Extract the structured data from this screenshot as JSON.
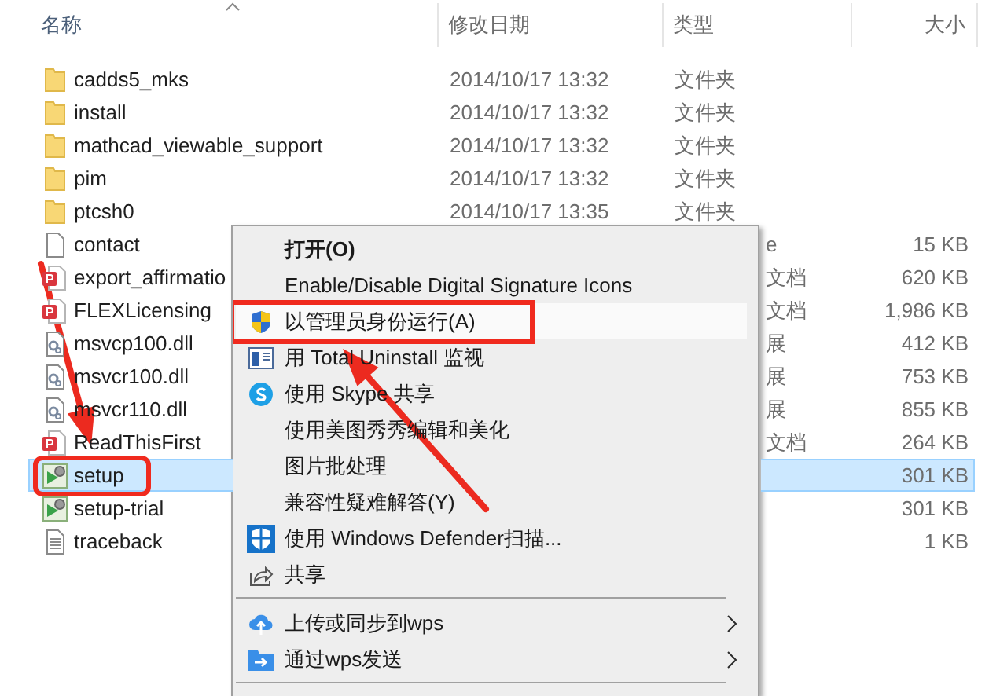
{
  "columns": [
    {
      "label": "名称",
      "sorted": true
    },
    {
      "label": "修改日期",
      "sorted": false
    },
    {
      "label": "类型",
      "sorted": false
    },
    {
      "label": "大小",
      "sorted": false
    }
  ],
  "rows": [
    {
      "kind": "folder",
      "name": "cadds5_mks",
      "date": "2014/10/17 13:32",
      "type": "文件夹",
      "selected": false
    },
    {
      "kind": "folder",
      "name": "install",
      "date": "2014/10/17 13:32",
      "type": "文件夹",
      "selected": false
    },
    {
      "kind": "folder",
      "name": "mathcad_viewable_support",
      "date": "2014/10/17 13:32",
      "type": "文件夹",
      "selected": false
    },
    {
      "kind": "folder",
      "name": "pim",
      "date": "2014/10/17 13:32",
      "type": "文件夹",
      "selected": false
    },
    {
      "kind": "folder",
      "name": "ptcsh0",
      "date": "2014/10/17 13:35",
      "type": "文件夹",
      "selected": false
    },
    {
      "kind": "file",
      "name": "contact",
      "type": "e",
      "size": "15 KB",
      "selected": false
    },
    {
      "kind": "pdf",
      "name": "export_affirmatio",
      "type": "文档",
      "size": "620 KB",
      "selected": false
    },
    {
      "kind": "pdf",
      "name": "FLEXLicensing",
      "type": "文档",
      "size": "1,986 KB",
      "selected": false
    },
    {
      "kind": "dll",
      "name": "msvcp100.dll",
      "type": "展",
      "size": "412 KB",
      "selected": false
    },
    {
      "kind": "dll",
      "name": "msvcr100.dll",
      "type": "展",
      "size": "753 KB",
      "selected": false
    },
    {
      "kind": "dll",
      "name": "msvcr110.dll",
      "type": "展",
      "size": "855 KB",
      "selected": false
    },
    {
      "kind": "pdf",
      "name": "ReadThisFirst",
      "type": "文档",
      "size": "264 KB",
      "selected": false
    },
    {
      "kind": "exe",
      "name": "setup",
      "size": "301 KB",
      "selected": true,
      "annotated": true
    },
    {
      "kind": "exe",
      "name": "setup-trial",
      "size": "301 KB",
      "selected": false
    },
    {
      "kind": "text",
      "name": "traceback",
      "size": "1 KB",
      "selected": false
    }
  ],
  "context_menu": {
    "items": [
      {
        "kind": "plain",
        "label": "打开(O)",
        "default": true,
        "selected": false,
        "submenu": false,
        "annotated": false
      },
      {
        "kind": "plain",
        "label": "Enable/Disable Digital Signature Icons",
        "default": false,
        "selected": false,
        "submenu": false,
        "annotated": false
      },
      {
        "kind": "uac",
        "label": "以管理员身份运行(A)",
        "default": false,
        "selected": true,
        "submenu": false,
        "annotated": true
      },
      {
        "kind": "window",
        "label": "用 Total Uninstall 监视",
        "default": false,
        "selected": false,
        "submenu": false,
        "annotated": false
      },
      {
        "kind": "skype",
        "label": "使用 Skype 共享",
        "default": false,
        "selected": false,
        "submenu": false,
        "annotated": false
      },
      {
        "kind": "plain",
        "label": "使用美图秀秀编辑和美化",
        "default": false,
        "selected": false,
        "submenu": false,
        "annotated": false
      },
      {
        "kind": "plain",
        "label": "图片批处理",
        "default": false,
        "selected": false,
        "submenu": false,
        "annotated": false
      },
      {
        "kind": "plain",
        "label": "兼容性疑难解答(Y)",
        "default": false,
        "selected": false,
        "submenu": false,
        "annotated": false
      },
      {
        "kind": "defender",
        "label": "使用 Windows Defender扫描...",
        "default": false,
        "selected": false,
        "submenu": false,
        "annotated": false
      },
      {
        "kind": "share",
        "label": "共享",
        "default": false,
        "selected": false,
        "submenu": false,
        "annotated": false
      },
      {
        "kind": "separator"
      },
      {
        "kind": "cloud",
        "label": "上传或同步到wps",
        "default": false,
        "selected": false,
        "submenu": true,
        "annotated": false
      },
      {
        "kind": "send",
        "label": "通过wps发送",
        "default": false,
        "selected": false,
        "submenu": true,
        "annotated": false
      },
      {
        "kind": "separator"
      }
    ]
  }
}
